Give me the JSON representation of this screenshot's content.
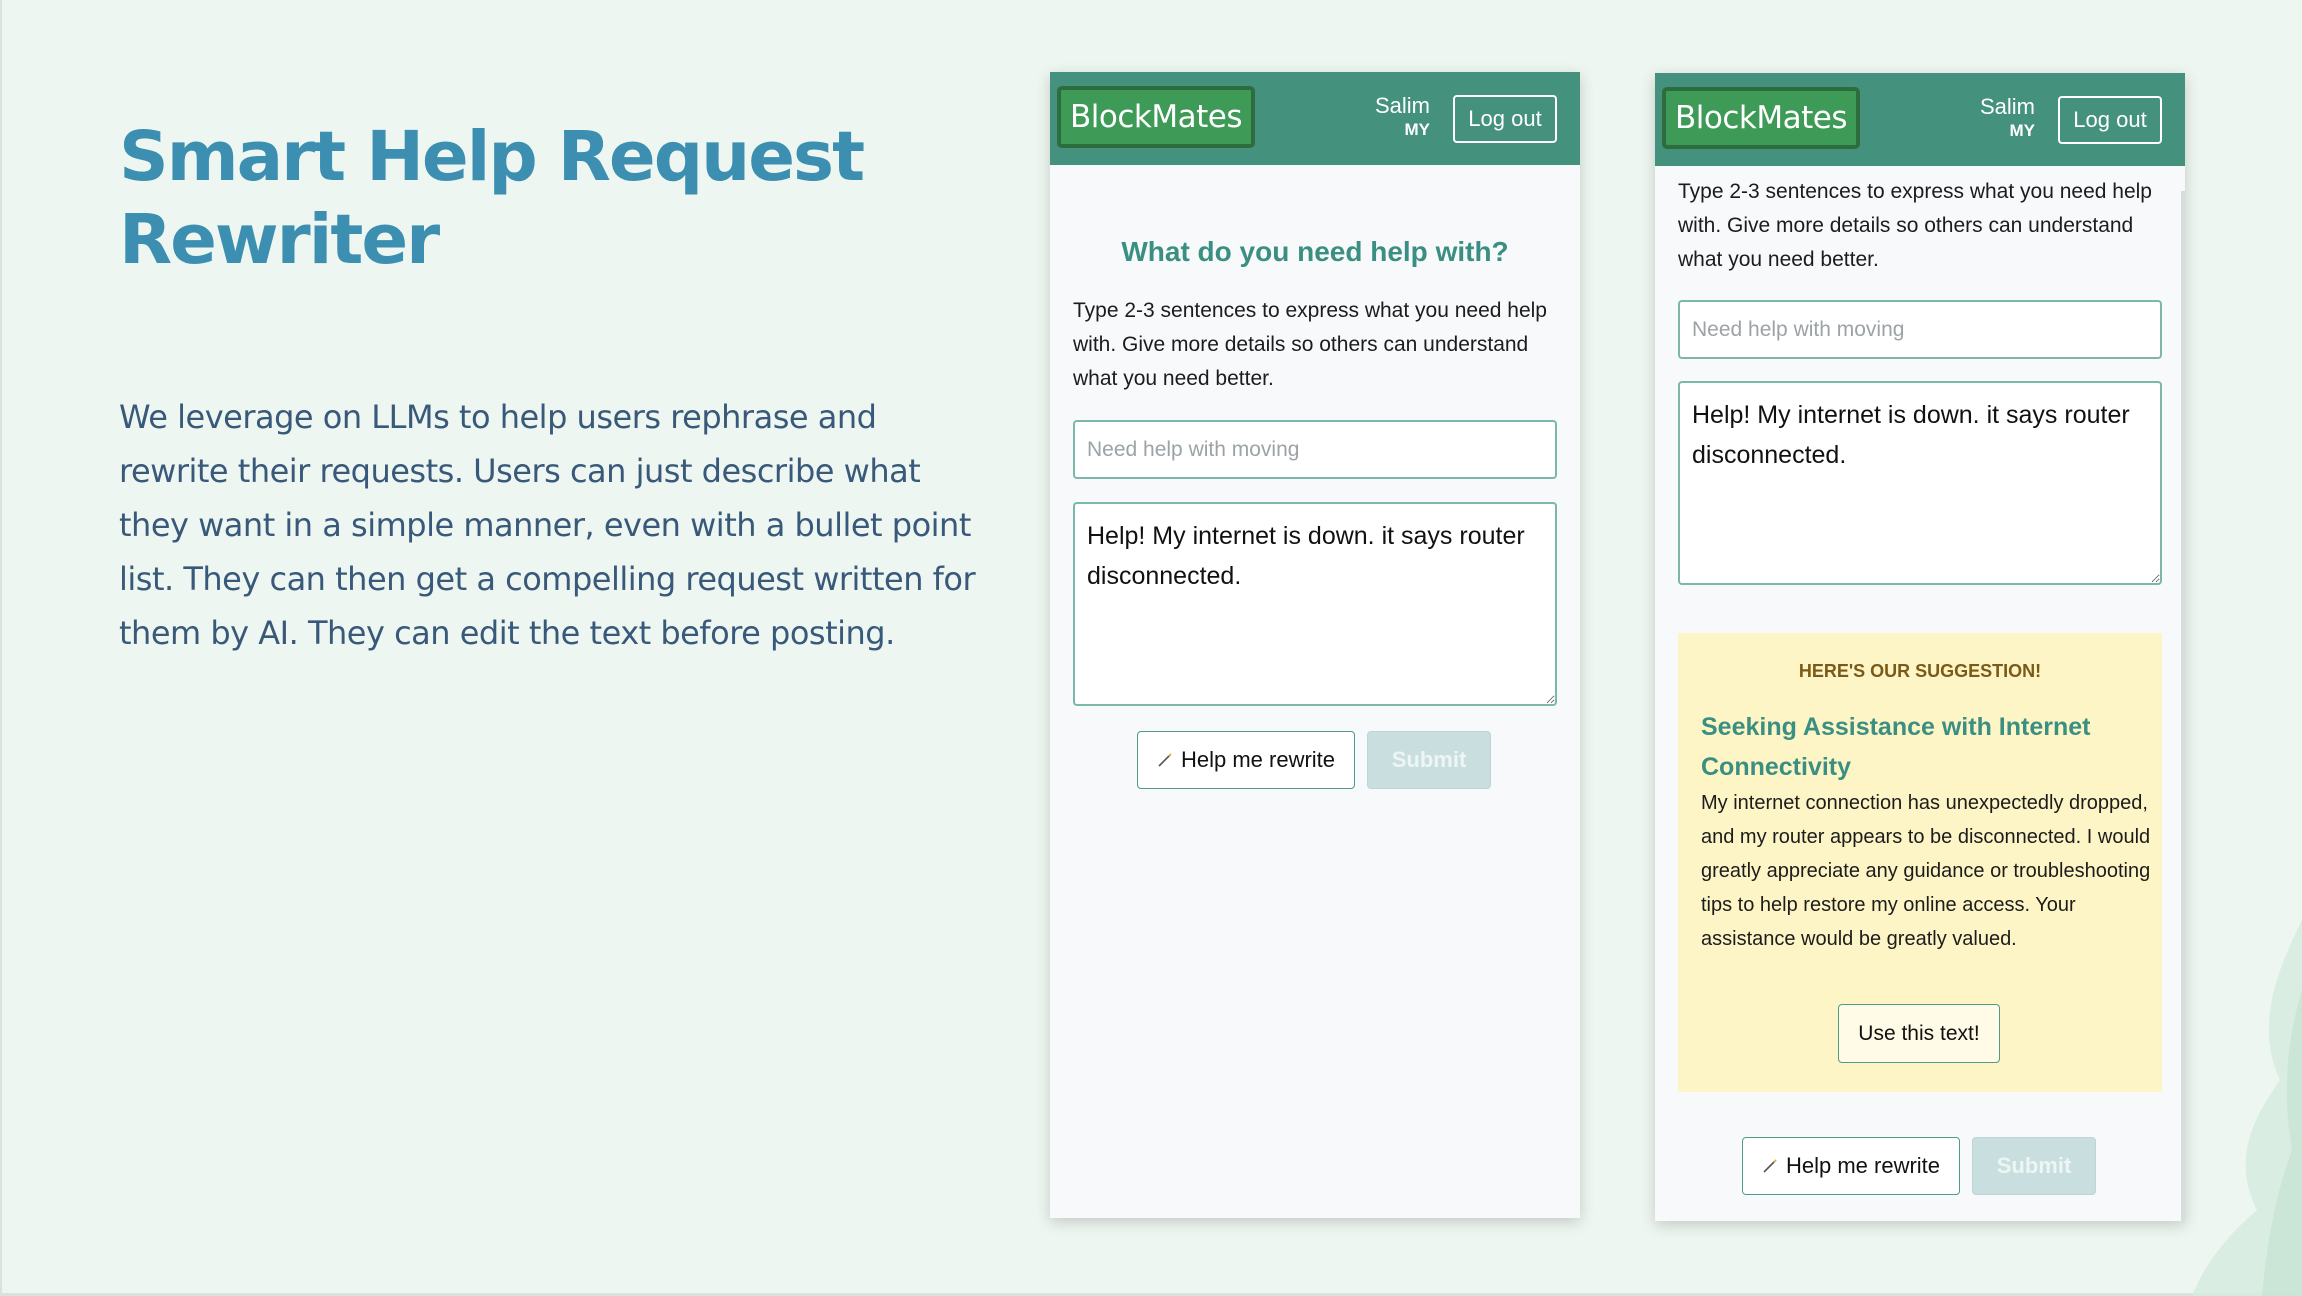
{
  "slide": {
    "title": "Smart Help Request Rewriter",
    "body": "We leverage on LLMs to help users rephrase and rewrite their requests. Users can just describe what they want in a simple manner, even with a bullet point list. They can then get a compelling request written for them by AI. They can edit the text before posting."
  },
  "header": {
    "logo": "BlockMates",
    "user_name": "Salim",
    "user_country": "MY",
    "logout_label": "Log out"
  },
  "form": {
    "heading": "What do you need help with?",
    "instructions": "Type 2-3 sentences to express what you need help with. Give more details so others can understand what you need better.",
    "title_placeholder": "Need help with moving",
    "description_value": "Help! My internet is down. it says router disconnected.",
    "rewrite_label": "Help me rewrite",
    "submit_label": "Submit"
  },
  "suggestion": {
    "label": "HERE'S OUR SUGGESTION!",
    "title": "Seeking Assistance with Internet Connectivity",
    "text": "My internet connection has unexpectedly dropped, and my router appears to be disconnected. I would greatly appreciate any guidance or troubleshooting tips to help restore my online access. Your assistance would be greatly valued.",
    "use_label": "Use this text!"
  },
  "icons": {
    "rewrite": "magic-wand-icon"
  },
  "colors": {
    "accent": "#44917e",
    "logo": "#3e9a57",
    "title": "#3c8fb0",
    "suggestion_bg": "#fdf5c6"
  }
}
